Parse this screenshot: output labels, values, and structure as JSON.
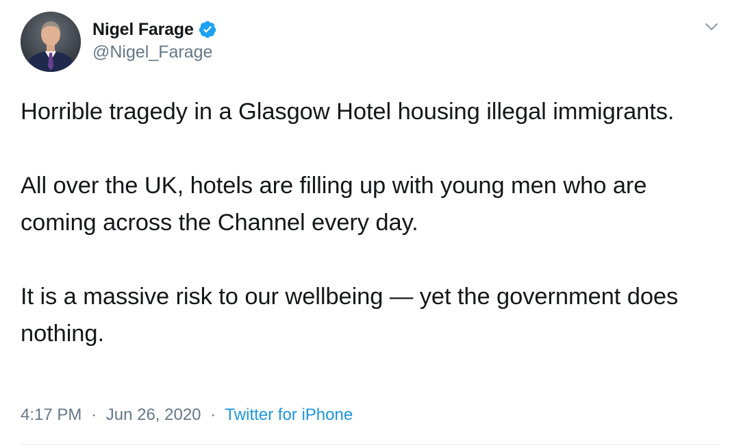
{
  "author": {
    "display_name": "Nigel Farage",
    "handle": "@Nigel_Farage",
    "verified": true
  },
  "tweet": {
    "paragraphs": [
      "Horrible tragedy in a Glasgow Hotel housing illegal immigrants.",
      "All over the UK, hotels are filling up with young men who are coming across the Channel every day.",
      "It is a massive risk to our wellbeing — yet the government does nothing."
    ],
    "time": "4:17 PM",
    "date": "Jun 26, 2020",
    "separator": "·",
    "source": "Twitter for iPhone"
  },
  "icons": {
    "verified": "verified-badge-icon",
    "menu": "chevron-down-icon"
  },
  "colors": {
    "text": "#14171a",
    "secondary": "#657786",
    "link": "#1b95e0",
    "verified": "#1da1f2"
  }
}
